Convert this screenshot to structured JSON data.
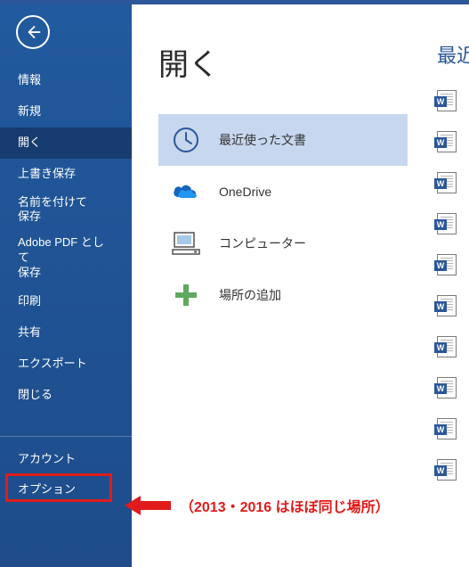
{
  "sidebar": {
    "items": [
      {
        "label": "情報",
        "key": "info"
      },
      {
        "label": "新規",
        "key": "new"
      },
      {
        "label": "開く",
        "key": "open",
        "active": true
      },
      {
        "label": "上書き保存",
        "key": "save"
      },
      {
        "label": "名前を付けて保存",
        "key": "saveas"
      },
      {
        "label": "Adobe PDF として保存",
        "key": "adobepdf"
      },
      {
        "label": "印刷",
        "key": "print"
      },
      {
        "label": "共有",
        "key": "share"
      },
      {
        "label": "エクスポート",
        "key": "export"
      },
      {
        "label": "閉じる",
        "key": "close"
      }
    ],
    "bottom_items": [
      {
        "label": "アカウント",
        "key": "account"
      },
      {
        "label": "オプション",
        "key": "options",
        "highlight": true
      }
    ]
  },
  "page": {
    "title": "開く"
  },
  "open_locations": [
    {
      "label": "最近使った文書",
      "icon": "clock",
      "selected": true
    },
    {
      "label": "OneDrive",
      "icon": "onedrive"
    },
    {
      "label": "コンピューター",
      "icon": "computer"
    },
    {
      "label": "場所の追加",
      "icon": "add"
    }
  ],
  "right": {
    "title": "最近",
    "doc_count": 10
  },
  "annotation": {
    "text": "（2013・2016 はほぼ同じ場所）"
  }
}
